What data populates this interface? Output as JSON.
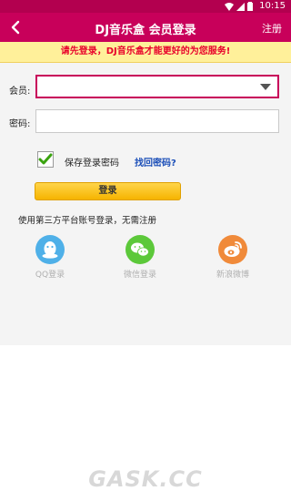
{
  "status_bar": {
    "time": "10:15"
  },
  "header": {
    "title": "DJ音乐盒 会员登录",
    "register_label": "注册"
  },
  "notice": "请先登录，DJ音乐盒才能更好的为您服务!",
  "form": {
    "member_label": "会员:",
    "member_value": "",
    "password_label": "密码:",
    "password_value": "",
    "save_password_label": "保存登录密码",
    "save_password_checked": true,
    "forgot_password_label": "找回密码?",
    "login_label": "登录"
  },
  "third_party": {
    "hint": "使用第三方平台账号登录，无需注册",
    "providers": [
      {
        "label": "QQ登录",
        "icon": "qq-icon",
        "color": "#4fb0e8"
      },
      {
        "label": "微信登录",
        "icon": "wechat-icon",
        "color": "#5cc83a"
      },
      {
        "label": "新浪微博",
        "icon": "weibo-icon",
        "color": "#f08a3a"
      }
    ]
  },
  "watermark": "GASK.CC",
  "colors": {
    "header": "#c8005a",
    "status_bar": "#b3004f",
    "notice_bg": "#fff09a",
    "notice_text": "#e8002a",
    "login_button": "#f6b400"
  }
}
